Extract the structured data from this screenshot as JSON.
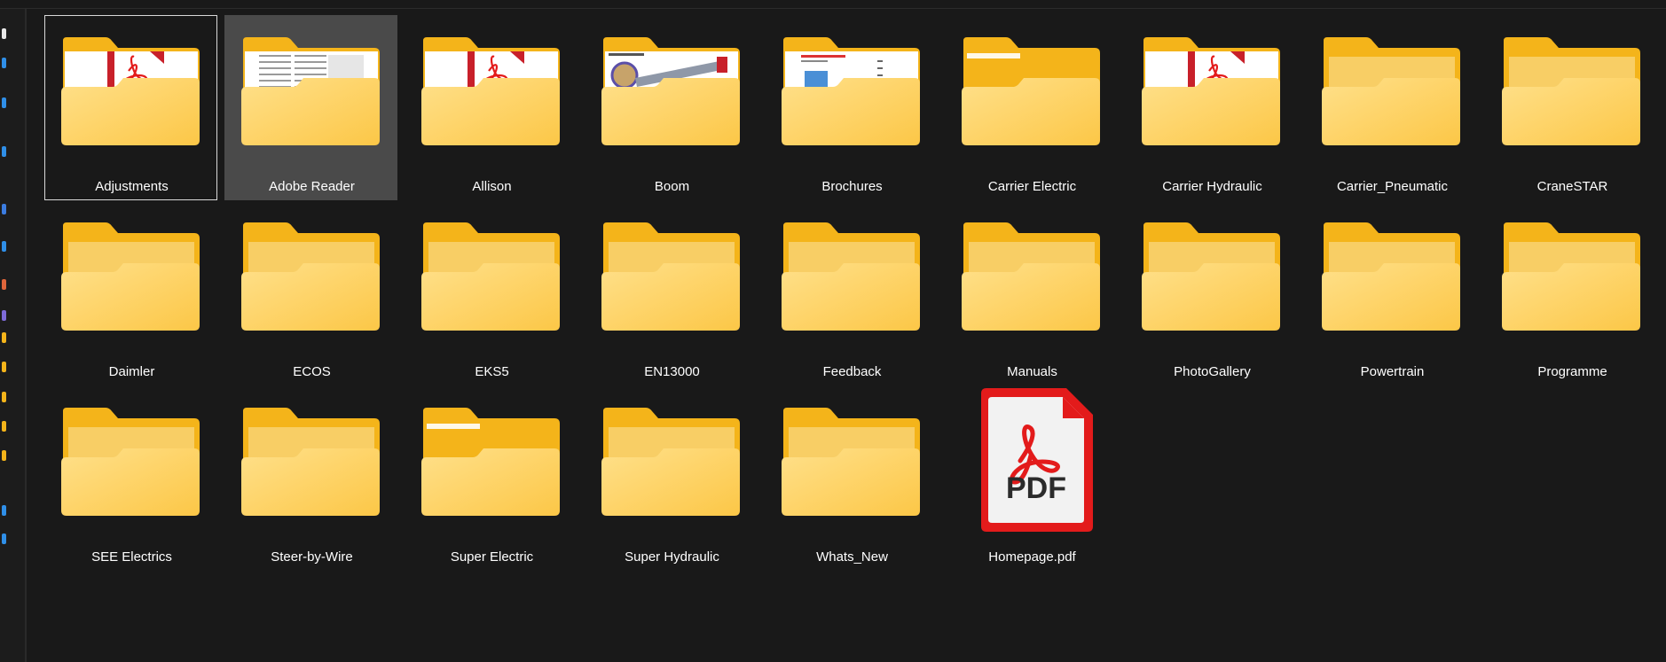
{
  "items": [
    {
      "label": "Adjustments",
      "kind": "folder-pdf"
    },
    {
      "label": "Adobe Reader",
      "kind": "folder-doc"
    },
    {
      "label": "Allison",
      "kind": "folder-pdf"
    },
    {
      "label": "Boom",
      "kind": "folder-drawing"
    },
    {
      "label": "Brochures",
      "kind": "folder-brochure"
    },
    {
      "label": "Carrier Electric",
      "kind": "folder-paper"
    },
    {
      "label": "Carrier Hydraulic",
      "kind": "folder-pdf"
    },
    {
      "label": "Carrier_Pneumatic",
      "kind": "folder"
    },
    {
      "label": "CraneSTAR",
      "kind": "folder"
    },
    {
      "label": "Daimler",
      "kind": "folder"
    },
    {
      "label": "ECOS",
      "kind": "folder"
    },
    {
      "label": "EKS5",
      "kind": "folder"
    },
    {
      "label": "EN13000",
      "kind": "folder"
    },
    {
      "label": "Feedback",
      "kind": "folder"
    },
    {
      "label": "Manuals",
      "kind": "folder"
    },
    {
      "label": "PhotoGallery",
      "kind": "folder"
    },
    {
      "label": "Powertrain",
      "kind": "folder"
    },
    {
      "label": "Programme",
      "kind": "folder"
    },
    {
      "label": "SEE Electrics",
      "kind": "folder"
    },
    {
      "label": "Steer-by-Wire",
      "kind": "folder"
    },
    {
      "label": "Super Electric",
      "kind": "folder-paper"
    },
    {
      "label": "Super Hydraulic",
      "kind": "folder-empty"
    },
    {
      "label": "Whats_New",
      "kind": "folder-empty"
    },
    {
      "label": "Homepage.pdf",
      "kind": "pdf-file",
      "badge": "PDF"
    }
  ],
  "selection": {
    "focused_item": "Adjustments",
    "hovered_item": "Adobe Reader"
  },
  "colors": {
    "background": "#191919",
    "folder_back": "#f4b41a",
    "folder_front": "#ffd666",
    "pdf_red": "#e31b1b",
    "hover": "#4a4a4a"
  }
}
